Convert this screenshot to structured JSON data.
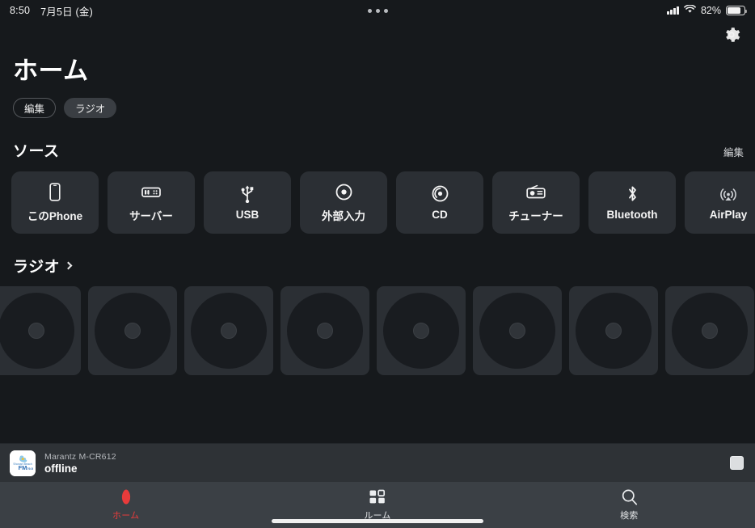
{
  "statusbar": {
    "time": "8:50",
    "date": "7月5日 (金)",
    "battery_percent": "82%",
    "cellular_icon": "signal-bars-icon",
    "wifi_icon": "wifi-icon",
    "battery_icon": "battery-icon",
    "multitask_icon": "more-dots-icon"
  },
  "header": {
    "settings_icon": "gear-icon",
    "title": "ホーム",
    "pills": [
      {
        "label": "編集",
        "style": "outline",
        "name": "edit-pill"
      },
      {
        "label": "ラジオ",
        "style": "filled",
        "name": "radio-pill"
      }
    ]
  },
  "sources": {
    "section_title": "ソース",
    "action_label": "編集",
    "items": [
      {
        "label": "このPhone",
        "icon": "phone-icon"
      },
      {
        "label": "サーバー",
        "icon": "server-icon"
      },
      {
        "label": "USB",
        "icon": "usb-icon"
      },
      {
        "label": "外部入力",
        "icon": "aux-input-icon"
      },
      {
        "label": "CD",
        "icon": "cd-disc-icon"
      },
      {
        "label": "チューナー",
        "icon": "tuner-radio-icon"
      },
      {
        "label": "Bluetooth",
        "icon": "bluetooth-icon"
      },
      {
        "label": "AirPlay",
        "icon": "airplay-icon"
      }
    ]
  },
  "radio": {
    "section_title": "ラジオ",
    "chevron_icon": "chevron-right-icon",
    "tile_count": 8,
    "tile_placeholder_icon": "disc-placeholder-icon"
  },
  "nowplaying": {
    "artwork_icon": "station-artwork-icon",
    "device": "Marantz M-CR612",
    "status": "offline",
    "action_icon": "stop-button-icon"
  },
  "tabbar": {
    "tabs": [
      {
        "label": "ホーム",
        "icon": "home-icon",
        "active": true
      },
      {
        "label": "ルーム",
        "icon": "rooms-grid-icon",
        "active": false
      },
      {
        "label": "検索",
        "icon": "search-icon",
        "active": false
      }
    ]
  },
  "colors": {
    "background": "#16191c",
    "card": "#2b2f34",
    "nowplaying_bar": "#2e3236",
    "tabbar": "#3b4045",
    "accent": "#e83b3b"
  }
}
